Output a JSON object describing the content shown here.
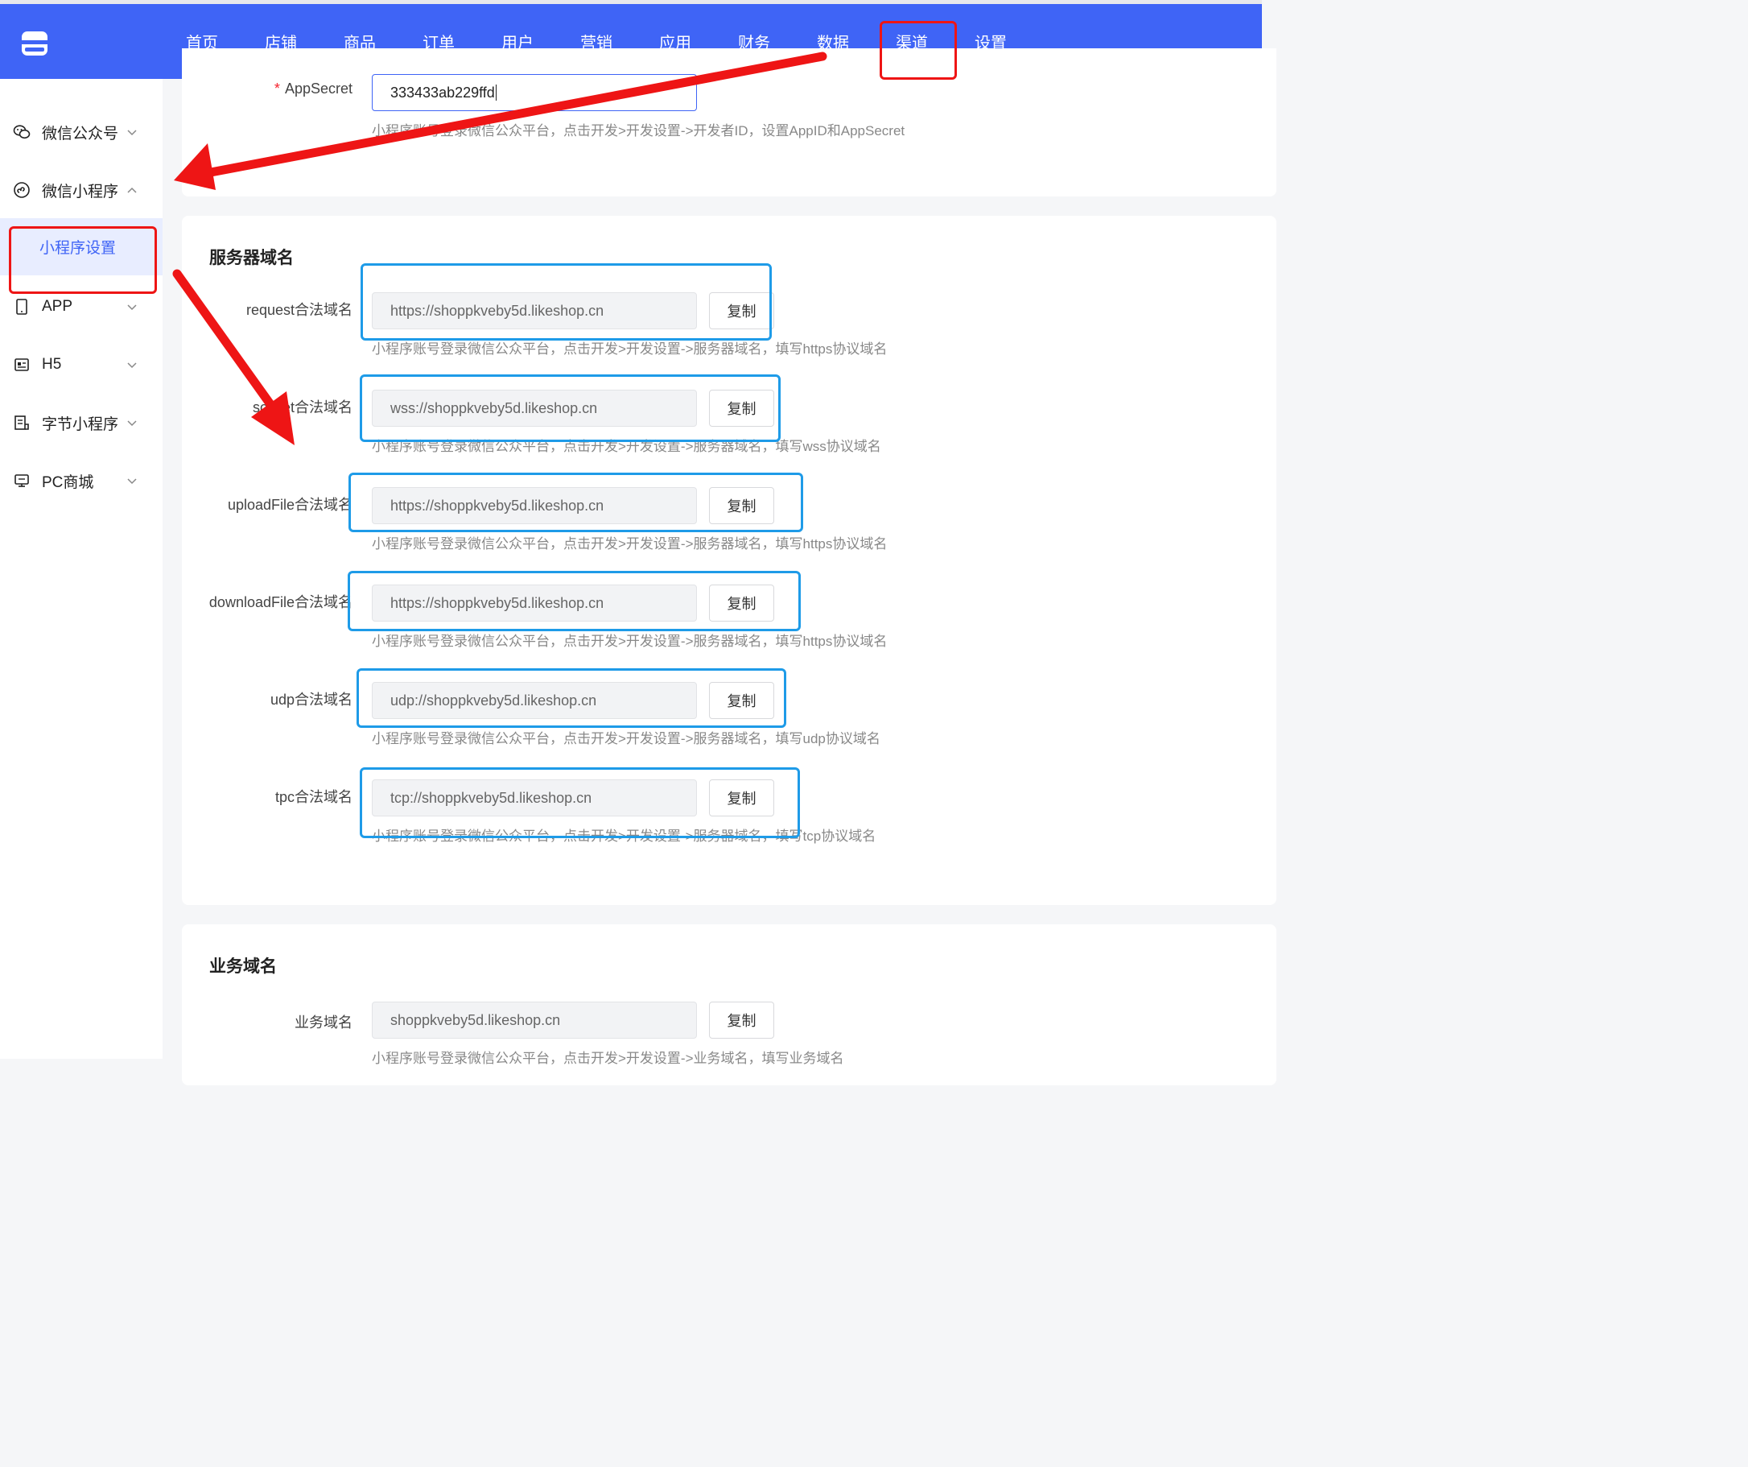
{
  "topnav": {
    "items": [
      "首页",
      "店铺",
      "商品",
      "订单",
      "用户",
      "营销",
      "应用",
      "财务",
      "数据",
      "渠道",
      "设置"
    ],
    "active_index": 9
  },
  "sidebar": {
    "groups": [
      {
        "label": "微信公众号",
        "icon": "wechat-icon",
        "expanded": false
      },
      {
        "label": "微信小程序",
        "icon": "miniprogram-icon",
        "expanded": true
      },
      {
        "label": "APP",
        "icon": "mobile-icon",
        "expanded": false
      },
      {
        "label": "H5",
        "icon": "h5-icon",
        "expanded": false
      },
      {
        "label": "字节小程序",
        "icon": "bytedance-icon",
        "expanded": false
      },
      {
        "label": "PC商城",
        "icon": "monitor-icon",
        "expanded": false
      }
    ],
    "active_sub": "小程序设置"
  },
  "appsecret": {
    "label": "AppSecret",
    "value": "333433ab229ffd",
    "hint": "小程序账号登录微信公众平台，点击开发>开发设置->开发者ID，设置AppID和AppSecret"
  },
  "server_domains": {
    "title": "服务器域名",
    "copy_label": "复制",
    "rows": [
      {
        "label": "request合法域名",
        "value": "https://shoppkveby5d.likeshop.cn",
        "hint": "小程序账号登录微信公众平台，点击开发>开发设置->服务器域名，填写https协议域名"
      },
      {
        "label": "socket合法域名",
        "value": "wss://shoppkveby5d.likeshop.cn",
        "hint": "小程序账号登录微信公众平台，点击开发>开发设置->服务器域名，填写wss协议域名"
      },
      {
        "label": "uploadFile合法域名",
        "value": "https://shoppkveby5d.likeshop.cn",
        "hint": "小程序账号登录微信公众平台，点击开发>开发设置->服务器域名，填写https协议域名"
      },
      {
        "label": "downloadFile合法域名",
        "value": "https://shoppkveby5d.likeshop.cn",
        "hint": "小程序账号登录微信公众平台，点击开发>开发设置->服务器域名，填写https协议域名"
      },
      {
        "label": "udp合法域名",
        "value": "udp://shoppkveby5d.likeshop.cn",
        "hint": "小程序账号登录微信公众平台，点击开发>开发设置->服务器域名，填写udp协议域名"
      },
      {
        "label": "tpc合法域名",
        "value": "tcp://shoppkveby5d.likeshop.cn",
        "hint": "小程序账号登录微信公众平台，点击开发>开发设置->服务器域名，填写tcp协议域名"
      }
    ]
  },
  "business_domain": {
    "title": "业务域名",
    "label": "业务域名",
    "value": "shoppkveby5d.likeshop.cn",
    "copy_label": "复制",
    "hint": "小程序账号登录微信公众平台，点击开发>开发设置->业务域名，填写业务域名"
  },
  "annotation_colors": {
    "red": "#ee1515",
    "blue": "#1e9be8",
    "brand": "#3f64f6"
  }
}
